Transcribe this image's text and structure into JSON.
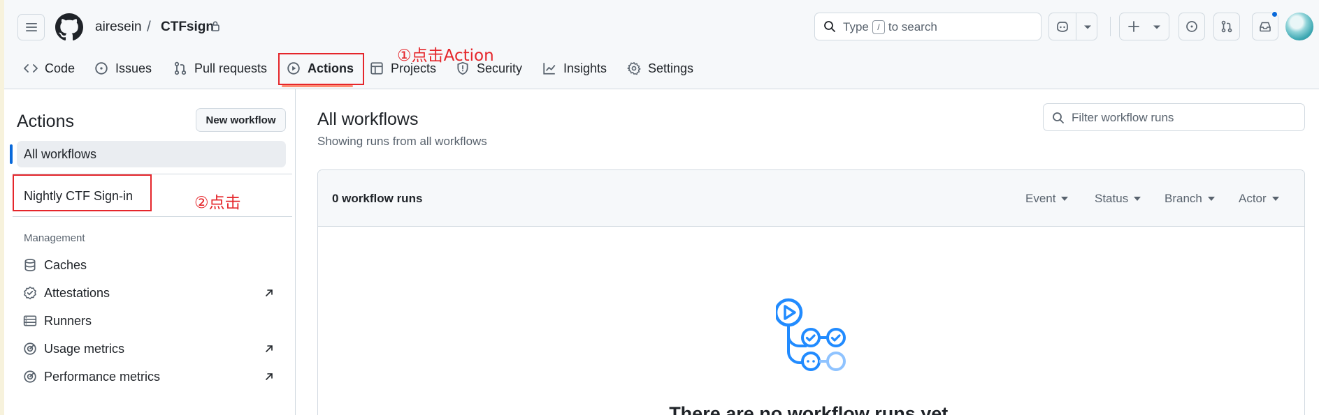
{
  "header": {
    "owner": "airesein",
    "separator": "/",
    "repo": "CTFsign",
    "search_label": "Type",
    "search_key": "/",
    "search_suffix": "to search"
  },
  "tabs": [
    {
      "label": "Code",
      "icon": "code-icon"
    },
    {
      "label": "Issues",
      "icon": "issue-icon"
    },
    {
      "label": "Pull requests",
      "icon": "pull-request-icon"
    },
    {
      "label": "Actions",
      "icon": "play-icon",
      "active": true
    },
    {
      "label": "Projects",
      "icon": "table-icon"
    },
    {
      "label": "Security",
      "icon": "shield-icon"
    },
    {
      "label": "Insights",
      "icon": "graph-icon"
    },
    {
      "label": "Settings",
      "icon": "gear-icon"
    }
  ],
  "annotations": {
    "step1": "①点击Action",
    "step2": "②点击",
    "color": "#e5262b"
  },
  "sidebar": {
    "title": "Actions",
    "new_workflow": "New workflow",
    "all_workflows": "All workflows",
    "workflows": [
      "Nightly CTF Sign-in"
    ],
    "management_heading": "Management",
    "management_items": [
      {
        "label": "Caches",
        "icon": "database-icon",
        "external": false
      },
      {
        "label": "Attestations",
        "icon": "verified-icon",
        "external": true
      },
      {
        "label": "Runners",
        "icon": "server-icon",
        "external": false
      },
      {
        "label": "Usage metrics",
        "icon": "meter-icon",
        "external": true
      },
      {
        "label": "Performance metrics",
        "icon": "meter-icon",
        "external": true
      }
    ]
  },
  "main": {
    "title": "All workflows",
    "subtitle": "Showing runs from all workflows",
    "filter_placeholder": "Filter workflow runs",
    "runs_count": "0 workflow runs",
    "filters": [
      "Event",
      "Status",
      "Branch",
      "Actor"
    ],
    "empty_title": "There are no workflow runs yet."
  },
  "colors": {
    "accent_blue": "#0969da",
    "active_tab_underline": "#fd8c73",
    "workflow_icon_blue": "#218bff"
  }
}
